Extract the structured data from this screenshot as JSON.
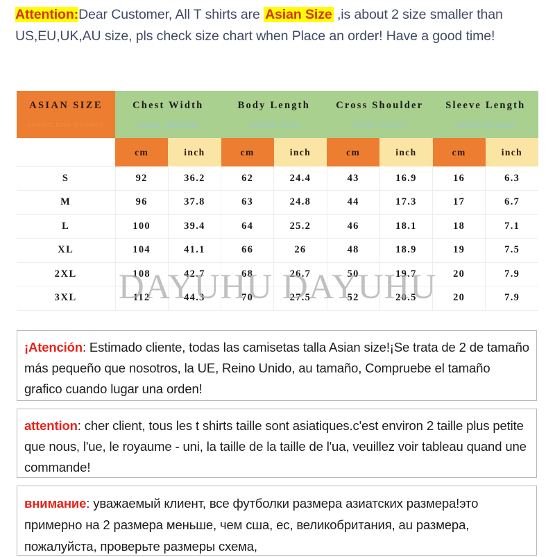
{
  "notice": {
    "attention_label": "Attention:",
    "part1": "Dear Customer, All T shirts are ",
    "asian_size_label": "Asian Size",
    "part2": " ,is about 2 size smaller than US,EU,UK,AU size, pls check size chart when Place an order! Have a good time!"
  },
  "colors": {
    "header_green": "#a9d08e",
    "header_orange": "#ed7d31",
    "unit_inch_yellow": "#fbe5a5",
    "highlight_yellow": "#ffff00",
    "attention_red": "#d9320a",
    "notice_text": "#3f4a63",
    "lead_red": "#e8221b",
    "watermark_gray": "#a8a8a8"
  },
  "table": {
    "corner_en": "ASIAN SIZE",
    "corner_ru": "азиатский размер",
    "groups": [
      {
        "en": "Chest Width",
        "ru": "грудь ширина"
      },
      {
        "en": "Body Length",
        "ru": "длина тела"
      },
      {
        "en": "Cross Shoulder",
        "ru": "через плечо"
      },
      {
        "en": "Sleeve Length",
        "ru": "длина рукава"
      }
    ],
    "units": [
      "cm",
      "inch",
      "cm",
      "inch",
      "cm",
      "inch",
      "cm",
      "inch"
    ],
    "rows": [
      {
        "size": "S",
        "values": [
          "92",
          "36.2",
          "62",
          "24.4",
          "43",
          "16.9",
          "16",
          "6.3"
        ]
      },
      {
        "size": "M",
        "values": [
          "96",
          "37.8",
          "63",
          "24.8",
          "44",
          "17.3",
          "17",
          "6.7"
        ]
      },
      {
        "size": "L",
        "values": [
          "100",
          "39.4",
          "64",
          "25.2",
          "46",
          "18.1",
          "18",
          "7.1"
        ]
      },
      {
        "size": "XL",
        "values": [
          "104",
          "41.1",
          "66",
          "26",
          "48",
          "18.9",
          "19",
          "7.5"
        ]
      },
      {
        "size": "2XL",
        "values": [
          "108",
          "42.7",
          "68",
          "26.7",
          "50",
          "19.7",
          "20",
          "7.9"
        ]
      },
      {
        "size": "3XL",
        "values": [
          "112",
          "44.3",
          "70",
          "27.5",
          "52",
          "20.5",
          "20",
          "7.9"
        ]
      }
    ]
  },
  "watermark": "DAYUHU DAYUHU",
  "notes": {
    "es": {
      "lead": "¡Atención",
      "body": ": Estimado cliente, todas las camisetas talla Asian size!¡Se trata de 2 de tamaño más pequeño que nosotros, la UE, Reino Unido, au tamaño, Compruebe el tamaño grafico cuando lugar una orden!"
    },
    "fr": {
      "lead": "attention",
      "body": ": cher client, tous les t shirts taille sont asiatiques.c'est environ 2 taille plus petite que nous, l'ue, le royaume - uni, la taille de la taille de l'ua, veuillez voir tableau quand une commande!"
    },
    "ru": {
      "lead": "внимание",
      "body": ": уважаемый клиент, все футболки размера азиатских размера!это примерно на 2 размера меньше, чем сша, ес, великобритания, au размера, пожалуйста, проверьте размеры схема,"
    }
  }
}
